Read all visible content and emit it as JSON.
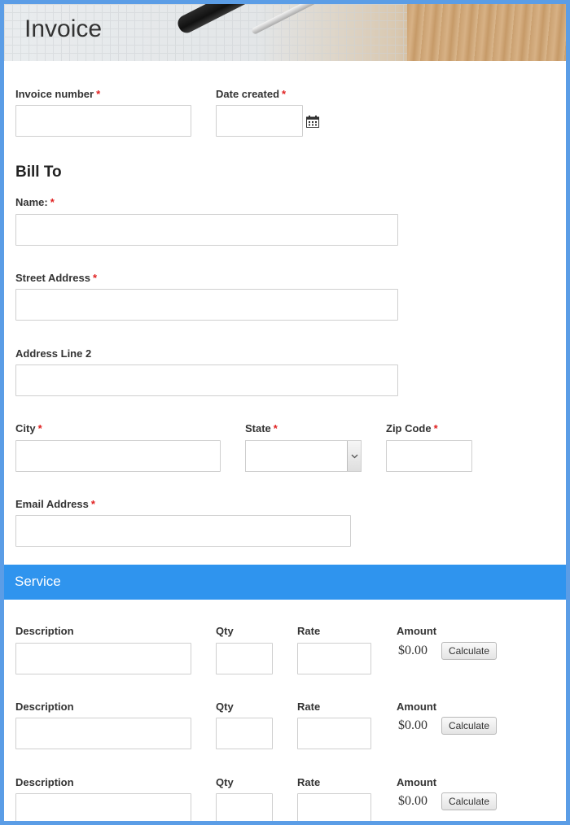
{
  "header": {
    "title": "Invoice"
  },
  "fields": {
    "invoice_number": {
      "label": "Invoice number",
      "required": "*"
    },
    "date_created": {
      "label": "Date created",
      "required": "*"
    }
  },
  "bill_to": {
    "heading": "Bill To",
    "name": {
      "label": "Name:",
      "required": "*"
    },
    "street": {
      "label": "Street Address",
      "required": "*"
    },
    "address2": {
      "label": "Address Line 2"
    },
    "city": {
      "label": "City",
      "required": "*"
    },
    "state": {
      "label": "State",
      "required": "*"
    },
    "zip": {
      "label": "Zip Code",
      "required": "*"
    },
    "email": {
      "label": "Email Address",
      "required": "*"
    }
  },
  "service": {
    "heading": "Service",
    "columns": {
      "description": "Description",
      "qty": "Qty",
      "rate": "Rate",
      "amount": "Amount"
    },
    "rows": [
      {
        "amount": "$0.00",
        "button": "Calculate"
      },
      {
        "amount": "$0.00",
        "button": "Calculate"
      },
      {
        "amount": "$0.00",
        "button": "Calculate"
      }
    ]
  },
  "icons": {
    "calendar": "calendar-icon",
    "dropdown": "chevron-down-icon"
  },
  "colors": {
    "accent": "#2f94ee",
    "frame": "#5b9de6",
    "required": "#e02020"
  }
}
